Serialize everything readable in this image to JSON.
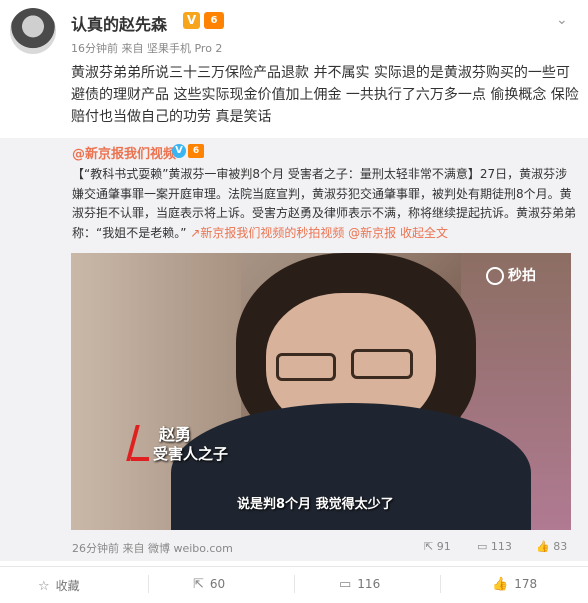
{
  "post": {
    "username": "认真的赵先森",
    "v_badge": "V",
    "vip_badge": "6",
    "menu_icon": "chevron-down-icon",
    "meta": "16分钟前 来自 坚果手机 Pro 2",
    "text": "黄淑芬弟弟所说三十三万保险产品退款 并不属实 实际退的是黄淑芬购买的一些可避债的理财产品 这些实际现金价值加上佣金 一共执行了六万多一点 偷换概念 保险赔付也当做自己的功劳 真是笑话"
  },
  "repost": {
    "author": "@新京报我们视频",
    "v_badge": "V",
    "vip_badge": "6",
    "text_main": "【“教科书式耍赖”黄淑芬一审被判8个月 受害者之子：量刑太轻非常不满意】27日，黄淑芬涉嫌交通肇事罪一案开庭审理。法院当庭宣判，黄淑芬犯交通肇事罪，被判处有期徒刑8个月。黄淑芬拒不认罪，当庭表示将上诉。受害方赵勇及律师表示不满，称将继续提起抗诉。黄淑芬弟弟称：“我姐不是老赖。”",
    "link_video": "新京报我们视频的秒拍视频",
    "link_at": "@新京报",
    "link_expand": "收起全文",
    "video": {
      "watermark": "秒拍",
      "name_caption": "赵勇",
      "role_caption": "受害人之子",
      "subtitle": "说是判8个月  我觉得太少了"
    },
    "footer_meta": "26分钟前 来自 微博 weibo.com",
    "reposts": "91",
    "comments": "113",
    "likes": "83"
  },
  "actions": {
    "favorite": "收藏",
    "repost": "60",
    "comment": "116",
    "like": "178"
  }
}
